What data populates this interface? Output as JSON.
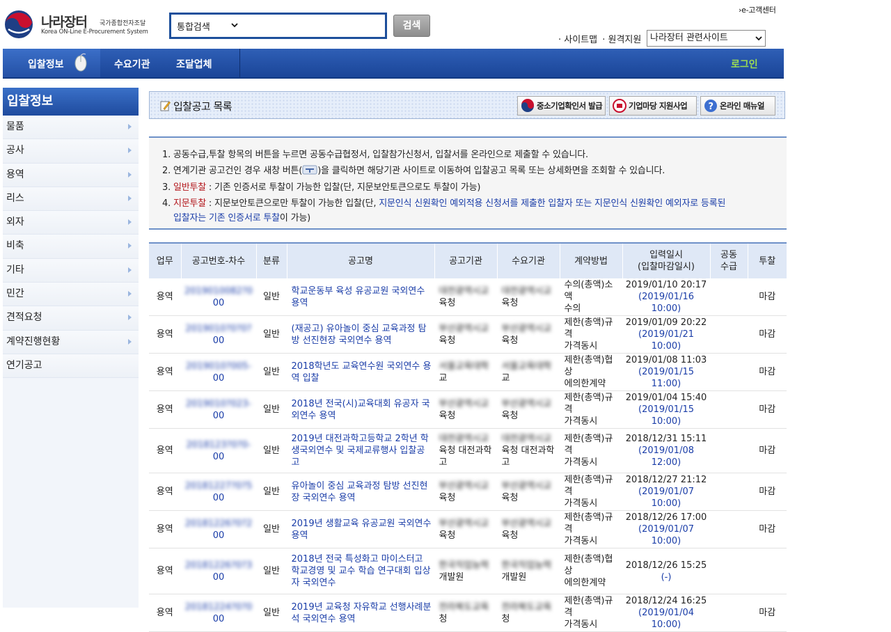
{
  "header": {
    "logo_name": "나라장터",
    "logo_sub": "국가종합전자조달",
    "logo_eng": "Korea ON-Line E-Procurement System",
    "search_scope": "통합검색",
    "search_value": "",
    "search_button": "검색",
    "customer_center": "›e-고객센터",
    "util_sitemap": "· 사이트맵",
    "util_remote": "· 원격지원",
    "related_sites": "나라장터 관련사이트"
  },
  "gnb": {
    "items": [
      "입찰정보",
      "수요기관",
      "조달업체"
    ],
    "login": "로그인"
  },
  "lnb": {
    "title": "입찰정보",
    "items": [
      "물품",
      "공사",
      "용역",
      "리스",
      "외자",
      "비축",
      "기타",
      "민간",
      "견적요청",
      "계약진행현황",
      "연기공고"
    ]
  },
  "titlebar": {
    "title": "입찰공고 목록",
    "buttons": [
      "중소기업확인서 발급",
      "기업마당 지원사업",
      "온라인 매뉴얼"
    ]
  },
  "notice": {
    "line1": "1. 공동수급,투찰 항목의 버튼을 누르면 공동수급협정서, 입찰참가신청서, 입찰서를 온라인으로 제출할 수 있습니다.",
    "line2_a": "2. 연계기관 공고건인 경우 새창 버튼(",
    "line2_b": ")을 클릭하면 해당기관 사이트로 이동하여 입찰공고 목록 또는 상세화면을 조회할 수 있습니다.",
    "line3_num": "3. ",
    "line3_red": "일반투찰",
    "line3_rest": " : 기존 인증서로 투찰이 가능한 입찰(단, 지문보안토큰으로도 투찰이 가능)",
    "line4_num": "4. ",
    "line4_red": "지문투찰",
    "line4_rest": " : 지문보안토큰으로만 투찰이 가능한 입찰(단, ",
    "line4_blue": "지문인식 신원확인 예외적용 신청서를 제출한 입찰자 또는 지문인식 신원확인 예외자로 등록된",
    "line5_blue": "입찰자는 기존 인증서로 투찰",
    "line5_rest": "이 가능)"
  },
  "table": {
    "headers": [
      "업무",
      "공고번호-차수",
      "분류",
      "공고명",
      "공고기관",
      "수요기관",
      "계약방법",
      "입력일시\n(입찰마감일시)",
      "공동\n수급",
      "투찰"
    ],
    "rows": [
      {
        "biz": "용역",
        "no": "2019010082?0",
        "ord": "00",
        "cls": "일반",
        "name": "학교운동부 육성 유공교원 국외연수 용역",
        "org1": "대전광역시교",
        "org2": "육청",
        "dem1": "대전광역시교",
        "dem2": "육청",
        "method1": "수의(총액)소액",
        "method2": "수의",
        "dt": "2019/01/10 20:17",
        "close": "(2019/01/16 10:00)",
        "joint": "",
        "bid": "마감"
      },
      {
        "biz": "용역",
        "no": "2019010?0?0?",
        "ord": "00",
        "cls": "일반",
        "name": "(재공고) 유아놀이 중심 교육과정 탐방 선진현장 국외연수 용역",
        "org1": "부산광역시교",
        "org2": "육청",
        "dem1": "부산광역시교",
        "dem2": "육청",
        "method1": "제한(총액)규격",
        "method2": "가격동시",
        "dt": "2019/01/09 20:22",
        "close": "(2019/01/21 10:00)",
        "joint": "",
        "bid": "마감"
      },
      {
        "biz": "용역",
        "no": "2019010?005-",
        "ord": "00",
        "cls": "일반",
        "name": "2018학년도 교육연수원 국외연수 용역 입찰",
        "org1": "서울교육대학",
        "org2": "교",
        "dem1": "서울교육대학",
        "dem2": "교",
        "method1": "제한(총액)협상",
        "method2": "에의한계약",
        "dt": "2019/01/08 11:03",
        "close": "(2019/01/15 11:00)",
        "joint": "",
        "bid": "마감"
      },
      {
        "biz": "용역",
        "no": "2019010?023-",
        "ord": "00",
        "cls": "일반",
        "name": "2018년 전국(시)교육대회 유공자 국외연수 용역",
        "org1": "부산광역시교",
        "org2": "육청",
        "dem1": "부산광역시교",
        "dem2": "육청",
        "method1": "제한(총액)규격",
        "method2": "가격동시",
        "dt": "2019/01/04 15:40",
        "close": "(2019/01/15 10:00)",
        "joint": "",
        "bid": "마감"
      },
      {
        "biz": "용역",
        "no": "2018123?0?0-",
        "ord": "00",
        "cls": "일반",
        "name": "2019년 대전과학고등학교 2학년 학생국외연수 및 국제교류행사 입찰공고",
        "org1": "대전광역시교",
        "org2": "육청 대전과학고",
        "dem1": "대전광역시교",
        "dem2": "육청 대전과학고",
        "method1": "제한(총액)규격",
        "method2": "가격동시",
        "dt": "2018/12/31 15:11",
        "close": "(2019/01/08 12:00)",
        "joint": "",
        "bid": "마감"
      },
      {
        "biz": "용역",
        "no": "20181227?0?5",
        "ord": "00",
        "cls": "일반",
        "name": "유아놀이 중심 교육과정 탐방 선진현장 국외연수 용역",
        "org1": "부산광역시교",
        "org2": "육청",
        "dem1": "부산광역시교",
        "dem2": "육청",
        "method1": "제한(총액)규격",
        "method2": "가격동시",
        "dt": "2018/12/27 21:12",
        "close": "(2019/01/07 10:00)",
        "joint": "",
        "bid": "마감"
      },
      {
        "biz": "용역",
        "no": "20181226?0?2",
        "ord": "00",
        "cls": "일반",
        "name": "2019년 생활교육 유공교원 국외연수 용역",
        "org1": "부산광역시교",
        "org2": "육청",
        "dem1": "부산광역시교",
        "dem2": "육청",
        "method1": "제한(총액)규격",
        "method2": "가격동시",
        "dt": "2018/12/26 17:00",
        "close": "(2019/01/07 10:00)",
        "joint": "",
        "bid": "마감"
      },
      {
        "biz": "용역",
        "no": "20181226?0?3",
        "ord": "00",
        "cls": "일반",
        "name": "2018년 전국 특성화고 마이스터고 학교경영 및 교수 학습 연구대회 입상자 국외연수",
        "org1": "한국직업능력",
        "org2": "개발원",
        "dem1": "한국직업능력",
        "dem2": "개발원",
        "method1": "제한(총액)협상",
        "method2": "에의한계약",
        "dt": "2018/12/26 15:25",
        "close": "(-)",
        "joint": "",
        "bid": ""
      },
      {
        "biz": "용역",
        "no": "20181224?0?0",
        "ord": "00",
        "cls": "일반",
        "name": "2019년 교육청 자유학교 선행사례분석 국외연수 용역",
        "org1": "전라북도교육",
        "org2": "청",
        "dem1": "전라북도교육",
        "dem2": "청",
        "method1": "제한(총액)규격",
        "method2": "가격동시",
        "dt": "2018/12/24 16:25",
        "close": "(2019/01/04 10:00)",
        "joint": "",
        "bid": "마감"
      }
    ]
  },
  "colors": {
    "brand_blue": "#1a4598",
    "login_green": "#9dde52",
    "link_blue": "#1a3da8",
    "alert_red": "#b3161b"
  }
}
